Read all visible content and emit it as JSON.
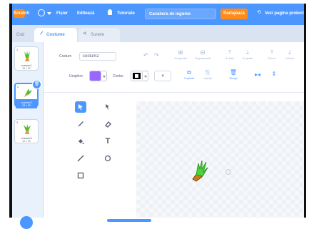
{
  "menubar": {
    "logo": "Scratch",
    "file": "Fișier",
    "edit": "Editează",
    "tutorials": "Tutoriale",
    "project_title": "Cavaliera de legume",
    "share": "Partajează",
    "see_project_page": "Vezi pagina proiectului"
  },
  "tabs": [
    {
      "label": "Cod"
    },
    {
      "label": "Costume"
    },
    {
      "label": "Sunete"
    }
  ],
  "costumes": [
    {
      "number": "1",
      "name": "costum1",
      "size": "36 x 55"
    },
    {
      "number": "2",
      "name": "costum2",
      "size": "33 x 33"
    },
    {
      "number": "3",
      "name": "costum3",
      "size": "36 x 55"
    }
  ],
  "editor": {
    "costume_label": "Costum",
    "costume_name": "costum2",
    "fill_label": "Umplere",
    "outline_label": "Contur",
    "outline_size": "4",
    "fill_color": "#9966ff",
    "outline_color": "#000000",
    "toolbar": {
      "group": "Grupează",
      "ungroup": "Degrupează",
      "forward": "În față",
      "backward": "În spate",
      "front": "Primul",
      "back": "Ultimul",
      "copy": "Copiază",
      "paste": "Lipește",
      "delete": "Șterge"
    }
  },
  "colors": {
    "accent": "#4c97ff",
    "share": "#ff8c1a",
    "brand": "#ff8c1a"
  }
}
